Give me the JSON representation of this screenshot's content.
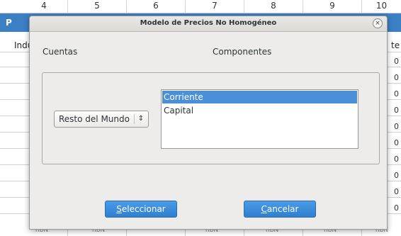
{
  "sheet": {
    "col_headers": [
      "4",
      "5",
      "6",
      "7",
      "8",
      "9",
      "10"
    ],
    "blue_row_label": "P",
    "left_label": "Indu",
    "right_label": "te",
    "edge_char": "0",
    "bottom_tags": [
      "nbN",
      "nbN",
      "nbN",
      "nbN",
      "nbN",
      "nbN"
    ]
  },
  "dialog": {
    "title": "Modelo de Precios No Homogéneo",
    "close_glyph": "×",
    "cuentas_label": "Cuentas",
    "componentes_label": "Componentes",
    "combo_value": "Resto del Mundo",
    "combo_arrow_glyph": "⇕",
    "list_items": [
      "Corriente",
      "Capital"
    ],
    "selected_index": 0,
    "select_button": {
      "mnemonic": "S",
      "rest": "eleccionar"
    },
    "cancel_button": {
      "mnemonic": "C",
      "rest": "ancelar"
    }
  },
  "colors": {
    "accent": "#4a90d9",
    "button": "#3a8bdc",
    "sheet_header_blue": "#3b7fc4"
  }
}
